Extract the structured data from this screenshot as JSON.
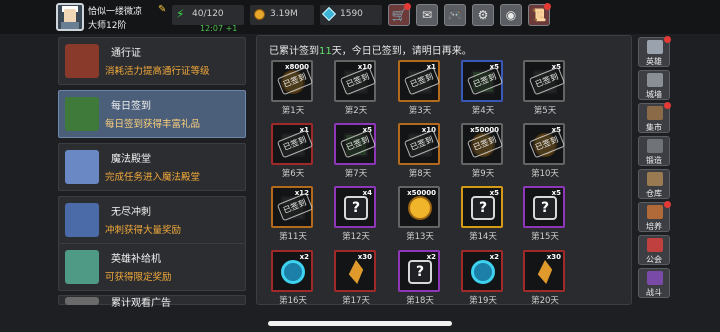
{
  "topbar": {
    "username": "恰似一缕微凉",
    "rank": "大师12阶",
    "energy": "40/120",
    "energy_timer": "12:07 +1",
    "gold": "3.19M",
    "gems": "1590",
    "buttons": [
      {
        "name": "shop-button",
        "icon": "cart-icon",
        "glyph": "🛒",
        "red": true,
        "dot": true
      },
      {
        "name": "mail-button",
        "icon": "mail-icon",
        "glyph": "✉",
        "red": false,
        "dot": false
      },
      {
        "name": "gamepad-button",
        "icon": "gamepad-icon",
        "glyph": "🎮",
        "red": false,
        "dot": false
      },
      {
        "name": "settings-button",
        "icon": "gear-icon",
        "glyph": "⚙",
        "red": false,
        "dot": false
      },
      {
        "name": "spin-button",
        "icon": "wheel-icon",
        "glyph": "◉",
        "red": false,
        "dot": false
      },
      {
        "name": "notice-button",
        "icon": "scroll-icon",
        "glyph": "📜",
        "red": true,
        "dot": true
      }
    ]
  },
  "menu": [
    {
      "title": "通行证",
      "sub": "消耗活力提高通行证等级",
      "icon": "goblet-icon",
      "active": false
    },
    {
      "title": "每日签到",
      "sub": "每日签到获得丰富礼品",
      "icon": "books-icon",
      "active": true
    },
    {
      "title": "魔法殿堂",
      "sub": "完成任务进入魔法殿堂",
      "icon": "crown-icon",
      "active": false
    },
    {
      "title": "无尽冲刺",
      "sub": "冲刺获得大量奖励",
      "icon": "knight-icon",
      "active": false
    },
    {
      "title": "英雄补给机",
      "sub": "可获得限定奖励",
      "icon": "machine-icon",
      "active": false
    },
    {
      "title": "累计观看广告",
      "sub": "",
      "icon": "ad-icon",
      "active": false
    }
  ],
  "main": {
    "notice_prefix": "已累计签到",
    "notice_count": "11",
    "notice_suffix": "天，今日已签到，请明日再来。",
    "stamp_text": "已签到",
    "days": [
      {
        "day": "第1天",
        "qty": "x8000",
        "item": "coin",
        "border": "gray",
        "claimed": true
      },
      {
        "day": "第2天",
        "qty": "x10",
        "item": "book-dark",
        "border": "gray",
        "claimed": true
      },
      {
        "day": "第3天",
        "qty": "x1",
        "item": "book-dark",
        "border": "orange",
        "claimed": true
      },
      {
        "day": "第4天",
        "qty": "x5",
        "item": "book-green",
        "border": "blue",
        "claimed": true
      },
      {
        "day": "第5天",
        "qty": "x5",
        "item": "book-dark",
        "border": "gray",
        "claimed": true
      },
      {
        "day": "第6天",
        "qty": "x1",
        "item": "book-dark",
        "border": "red",
        "claimed": true
      },
      {
        "day": "第7天",
        "qty": "x5",
        "item": "book-green",
        "border": "purple",
        "claimed": true
      },
      {
        "day": "第8天",
        "qty": "x10",
        "item": "book-dark",
        "border": "orange",
        "claimed": true
      },
      {
        "day": "第9天",
        "qty": "x50000",
        "item": "coin",
        "border": "gray",
        "claimed": true
      },
      {
        "day": "第10天",
        "qty": "x5",
        "item": "coin",
        "border": "gray",
        "claimed": true
      },
      {
        "day": "第11天",
        "qty": "x12",
        "item": "book-dark",
        "border": "orange",
        "claimed": true
      },
      {
        "day": "第12天",
        "qty": "x4",
        "item": "mystery",
        "border": "purple",
        "claimed": false
      },
      {
        "day": "第13天",
        "qty": "x50000",
        "item": "coin-bright",
        "border": "gray",
        "claimed": false
      },
      {
        "day": "第14天",
        "qty": "x5",
        "item": "mystery",
        "border": "yellow",
        "claimed": false
      },
      {
        "day": "第15天",
        "qty": "x5",
        "item": "mystery",
        "border": "purple",
        "claimed": false
      },
      {
        "day": "第16天",
        "qty": "x2",
        "item": "orb",
        "border": "red",
        "claimed": false
      },
      {
        "day": "第17天",
        "qty": "x30",
        "item": "crystal",
        "border": "red",
        "claimed": false
      },
      {
        "day": "第18天",
        "qty": "x2",
        "item": "mystery",
        "border": "purple",
        "claimed": false
      },
      {
        "day": "第19天",
        "qty": "x2",
        "item": "orb",
        "border": "red",
        "claimed": false
      },
      {
        "day": "第20天",
        "qty": "x30",
        "item": "crystal",
        "border": "red",
        "claimed": false
      }
    ]
  },
  "sidebar": [
    {
      "label": "英雄",
      "icon": "hero-icon",
      "color": "#9aa3ad",
      "dot": true
    },
    {
      "label": "城墙",
      "icon": "wall-icon",
      "color": "#8a8f96",
      "dot": false
    },
    {
      "label": "集市",
      "icon": "market-icon",
      "color": "#8b6a48",
      "dot": true
    },
    {
      "label": "锻造",
      "icon": "anvil-icon",
      "color": "#707478",
      "dot": false
    },
    {
      "label": "仓库",
      "icon": "warehouse-icon",
      "color": "#9a7a50",
      "dot": false
    },
    {
      "label": "培养",
      "icon": "training-icon",
      "color": "#b06a3a",
      "dot": true
    },
    {
      "label": "公会",
      "icon": "guild-icon",
      "color": "#c04040",
      "dot": false
    },
    {
      "label": "战斗",
      "icon": "battle-icon",
      "color": "#7a4aa8",
      "dot": false
    }
  ]
}
